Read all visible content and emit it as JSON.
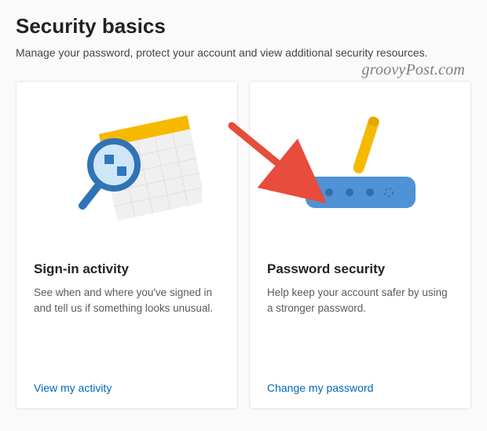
{
  "header": {
    "title": "Security basics",
    "subtitle": "Manage your password, protect your account and view additional security resources."
  },
  "watermark": "groovyPost.com",
  "cards": [
    {
      "title": "Sign-in activity",
      "description": "See when and where you've signed in and tell us if something looks unusual.",
      "link_label": "View my activity"
    },
    {
      "title": "Password security",
      "description": "Help keep your account safer by using a stronger password.",
      "link_label": "Change my password"
    }
  ],
  "colors": {
    "blue_primary": "#4f92d5",
    "blue_dark": "#3073b6",
    "yellow": "#f6b900",
    "link": "#0067b8",
    "arrow": "#e74c3c"
  }
}
